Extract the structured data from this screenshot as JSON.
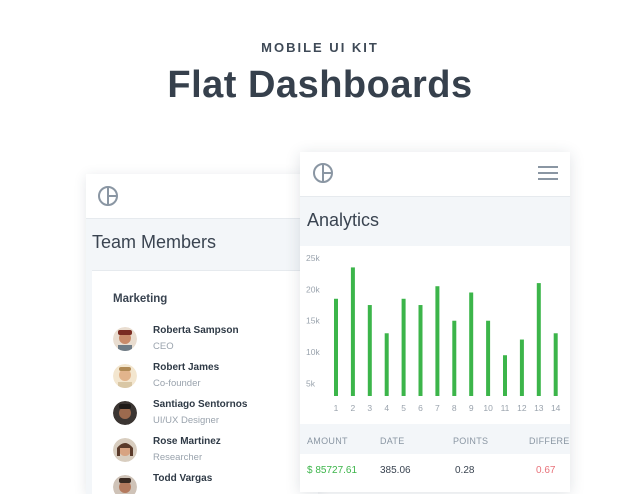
{
  "header": {
    "kit_label": "MOBILE UI KIT",
    "title": "Flat Dashboards"
  },
  "team_card": {
    "title": "Team Members",
    "group": "Marketing",
    "members": [
      {
        "name": "Roberta Sampson",
        "role": "CEO"
      },
      {
        "name": "Robert James",
        "role": "Co-founder"
      },
      {
        "name": "Santiago Sentornos",
        "role": "UI/UX Designer"
      },
      {
        "name": "Rose Martinez",
        "role": "Researcher"
      },
      {
        "name": "Todd Vargas",
        "role": ""
      }
    ]
  },
  "analytics_card": {
    "title": "Analytics",
    "table": {
      "headers": [
        "AMOUNT",
        "DATE",
        "POINTS",
        "DIFFEREN"
      ],
      "row": {
        "amount": "$ 85727.61",
        "date": "385.06",
        "points": "0.28",
        "difference": "0.67"
      }
    }
  },
  "colors": {
    "bar": "#3cb54a",
    "amount_green": "#3cb54a",
    "difference_red": "#e8727a"
  },
  "chart_data": {
    "type": "bar",
    "categories": [
      "1",
      "2",
      "3",
      "4",
      "5",
      "6",
      "7",
      "8",
      "9",
      "10",
      "11",
      "12",
      "13",
      "14"
    ],
    "values": [
      18500,
      23500,
      17500,
      13000,
      18500,
      17500,
      20500,
      15000,
      19500,
      15000,
      9500,
      12000,
      21000,
      13000
    ],
    "y_ticks": [
      "5k",
      "10k",
      "15k",
      "20k",
      "25k"
    ],
    "ylim": [
      3000,
      25000
    ],
    "grid": false
  }
}
